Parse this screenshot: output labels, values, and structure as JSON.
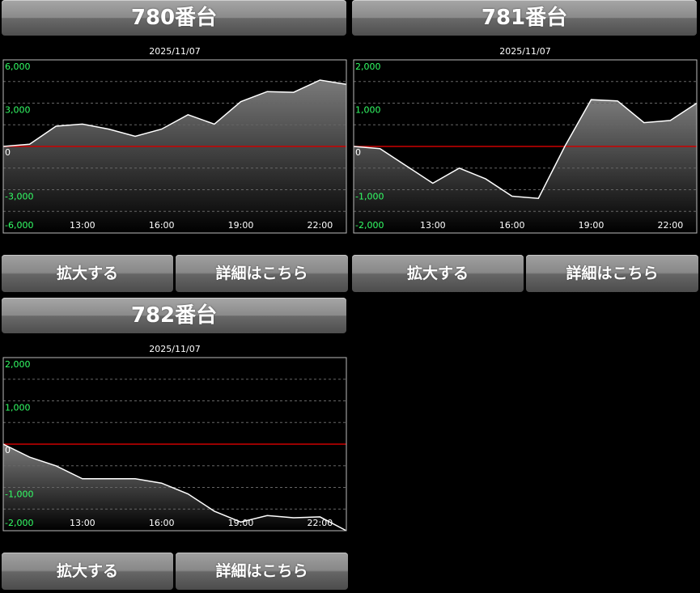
{
  "colors": {
    "background": "#000000",
    "grid": "#666666",
    "zero_line": "#cc0000",
    "tick_y": "#33ff66",
    "tick_x": "#ffffff",
    "series_line": "#ffffff"
  },
  "panels": [
    {
      "title": "780番台",
      "zoom_label": "拡大する",
      "detail_label": "詳細はこちら",
      "chart_data": {
        "type": "area",
        "title": "2025/11/07",
        "x_ticks": [
          "13:00",
          "16:00",
          "19:00",
          "22:00"
        ],
        "y_ticks": [
          "6,000",
          "3,000",
          "0",
          "-3,000",
          "-6,000"
        ],
        "ylim": [
          -6000,
          6000
        ],
        "x_hours": [
          10,
          11,
          12,
          13,
          14,
          15,
          16,
          17,
          18,
          19,
          20,
          21,
          22,
          23
        ],
        "values": [
          0,
          150,
          1400,
          1550,
          1200,
          700,
          1200,
          2200,
          1550,
          3100,
          3800,
          3750,
          4600,
          4300
        ]
      }
    },
    {
      "title": "781番台",
      "zoom_label": "拡大する",
      "detail_label": "詳細はこちら",
      "chart_data": {
        "type": "area",
        "title": "2025/11/07",
        "x_ticks": [
          "13:00",
          "16:00",
          "19:00",
          "22:00"
        ],
        "y_ticks": [
          "2,000",
          "1,000",
          "0",
          "-1,000",
          "-2,000"
        ],
        "ylim": [
          -2000,
          2000
        ],
        "x_hours": [
          10,
          11,
          12,
          13,
          14,
          15,
          16,
          17,
          18,
          19,
          20,
          21,
          22,
          23
        ],
        "values": [
          0,
          -50,
          -450,
          -850,
          -500,
          -750,
          -1150,
          -1200,
          0,
          1080,
          1050,
          550,
          600,
          1000
        ]
      }
    },
    {
      "title": "782番台",
      "zoom_label": "拡大する",
      "detail_label": "詳細はこちら",
      "chart_data": {
        "type": "area",
        "title": "2025/11/07",
        "x_ticks": [
          "13:00",
          "16:00",
          "19:00",
          "22:00"
        ],
        "y_ticks": [
          "2,000",
          "1,000",
          "0",
          "-1,000",
          "-2,000"
        ],
        "ylim": [
          -2000,
          2000
        ],
        "x_hours": [
          10,
          11,
          12,
          13,
          14,
          15,
          16,
          17,
          18,
          19,
          20,
          21,
          22,
          23
        ],
        "values": [
          0,
          -300,
          -500,
          -800,
          -800,
          -800,
          -900,
          -1150,
          -1550,
          -1800,
          -1650,
          -1700,
          -1680,
          -2000
        ]
      }
    }
  ]
}
